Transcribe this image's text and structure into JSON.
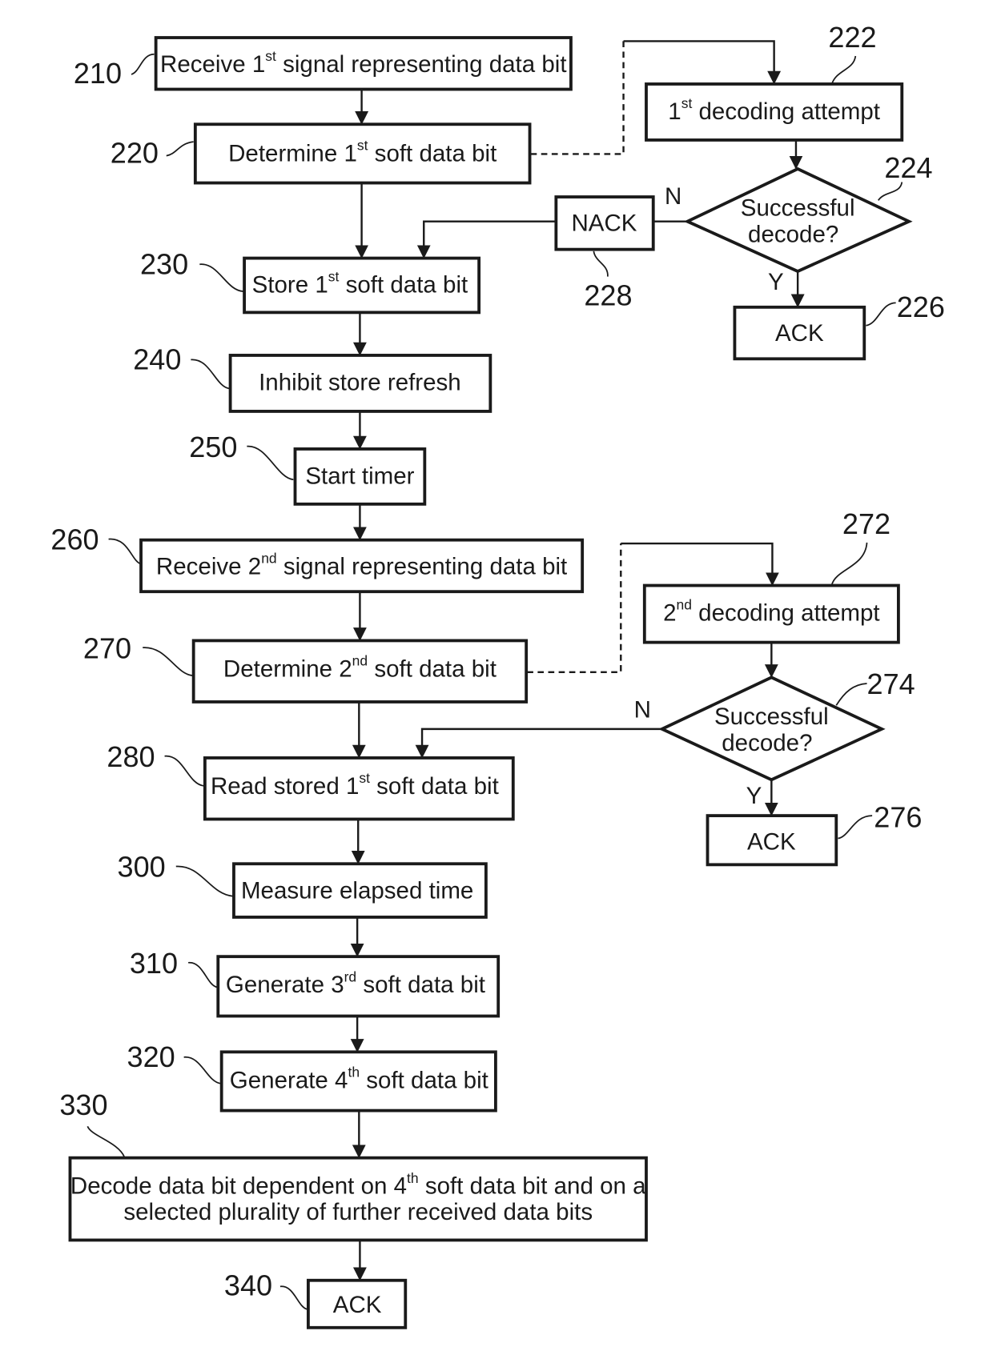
{
  "diagram": {
    "type": "flowchart",
    "steps": [
      {
        "ref": "210",
        "text": "Receive ",
        "num": "1",
        "sup": "st",
        "rest": " signal representing data bit"
      },
      {
        "ref": "220",
        "text": "Determine ",
        "num": "1",
        "sup": "st",
        "rest": " soft data bit"
      },
      {
        "ref": "230",
        "text": "Store ",
        "num": "1",
        "sup": "st",
        "rest": " soft data bit"
      },
      {
        "ref": "240",
        "text": "Inhibit store refresh"
      },
      {
        "ref": "250",
        "text": "Start timer"
      },
      {
        "ref": "260",
        "text": "Receive ",
        "num": "2",
        "sup": "nd",
        "rest": " signal representing data bit"
      },
      {
        "ref": "270",
        "text": "Determine ",
        "num": "2",
        "sup": "nd",
        "rest": " soft data bit"
      },
      {
        "ref": "280",
        "text": "Read stored ",
        "num": "1",
        "sup": "st",
        "rest": " soft data bit"
      },
      {
        "ref": "300",
        "text": "Measure elapsed time"
      },
      {
        "ref": "310",
        "text": "Generate ",
        "num": "3",
        "sup": "rd",
        "rest": " soft data bit"
      },
      {
        "ref": "320",
        "text": "Generate ",
        "num": "4",
        "sup": "th",
        "rest": " soft data bit"
      },
      {
        "ref": "330",
        "line1a": "Decode data bit dependent on ",
        "num": "4",
        "sup": "th",
        "line1b": " soft data bit and on a",
        "line2": "selected plurality of further received data bits"
      },
      {
        "ref": "340",
        "text": "ACK"
      }
    ],
    "branch1": {
      "attempt": {
        "ref": "222",
        "num": "1",
        "sup": "st",
        "rest": " decoding attempt"
      },
      "decision": {
        "ref": "224",
        "line1": "Successful",
        "line2": "decode?"
      },
      "nack": {
        "ref": "228",
        "text": "NACK"
      },
      "ack": {
        "ref": "226",
        "text": "ACK"
      },
      "no_label": "N",
      "yes_label": "Y"
    },
    "branch2": {
      "attempt": {
        "ref": "272",
        "num": "2",
        "sup": "nd",
        "rest": " decoding attempt"
      },
      "decision": {
        "ref": "274",
        "line1": "Successful",
        "line2": "decode?"
      },
      "ack": {
        "ref": "276",
        "text": "ACK"
      },
      "no_label": "N",
      "yes_label": "Y"
    }
  }
}
